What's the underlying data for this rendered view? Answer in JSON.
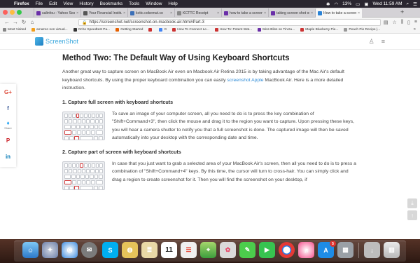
{
  "menubar": {
    "apple": "",
    "app": "Firefox",
    "items": [
      "File",
      "Edit",
      "View",
      "History",
      "Bookmarks",
      "Tools",
      "Window",
      "Help"
    ],
    "battery": "13%",
    "clock": "Wed 11:59 AM"
  },
  "tabs": [
    {
      "title": "salinfou - Yahoo Sear",
      "color": "#6a2ea8"
    },
    {
      "title": "Your Financial Institution",
      "color": "#555555"
    },
    {
      "title": "kcttc.cokernut.co",
      "color": "#3b6fb7"
    },
    {
      "title": "KCTTC Receipt",
      "color": "#888888"
    },
    {
      "title": "how to take a screenshot",
      "color": "#6a2ea8"
    },
    {
      "title": "taking screen shot on",
      "color": "#6a2ea8"
    },
    {
      "title": "How to take a screenshot",
      "color": "#2a82d6",
      "active": true
    }
  ],
  "address": {
    "url": "https://screenshot.net/screenshot-on-macbook-air.html#Part-3"
  },
  "bookmarks": [
    {
      "label": "Most Visited",
      "color": "#888888"
    },
    {
      "label": "amazon non virtual...",
      "color": "#f19e1a"
    },
    {
      "label": "Ocho Speedtest Pa...",
      "color": "#333333"
    },
    {
      "label": "Getting Started",
      "color": "#e66000"
    },
    {
      "label": "",
      "color": "#c33"
    },
    {
      "label": "G",
      "color": "#4285f4"
    },
    {
      "label": "How To Connect Le...",
      "color": "#c33"
    },
    {
      "label": "How To: Potent Wat...",
      "color": "#c33"
    },
    {
      "label": "Miss Bliss on Tinctu...",
      "color": "#6a2ea8"
    },
    {
      "label": "Maple Blueberry Pie...",
      "color": "#c33"
    },
    {
      "label": "Peach Pie Recipe |...",
      "color": "#999999"
    }
  ],
  "site": {
    "logo": "ScreenShot"
  },
  "share": {
    "share_label": "Share"
  },
  "article": {
    "title": "Method Two: The Default Way of Using Keyboard Shortcuts",
    "intro_1": "Another great way to capture screen on MacBook Air even  on Macbook Air Retina 2015 is by taking advantage of the Mac Air's default keyboard shortcuts. By using the proper keyboard combination you can easily ",
    "intro_link": "screenshot Apple",
    "intro_2": " MacBook Air. Here is a more detailed instruction.",
    "section1_title": "1. Capture full screen with keyboard shortcuts",
    "section1_text": "To save an image of your computer screen, all you need to do is to press the key combination of \"Shift+Command+3\", then click the mouse and drag it to the region you want to capture. Upon pressing these keys, you will hear a camera shutter to notify you that a full screenshot is done. The captured image will then be saved automatically into your desktop with the corresponding date and time.",
    "section2_title": "2. Capture part of screen with keyboard shortcuts",
    "section2_text": "In case that you just want to grab a selected area of your MacBook Air's screen, then all you need to do is to press a combination of \"Shift+Command+4\" keys. By this time, the cursor will turn to cross-hair. You can simply click and drag a region to create screenshot for it. Then you will find the screenshot on your desktop, if"
  },
  "dock": {
    "calendar_day": "11",
    "appstore_badge": "5"
  }
}
